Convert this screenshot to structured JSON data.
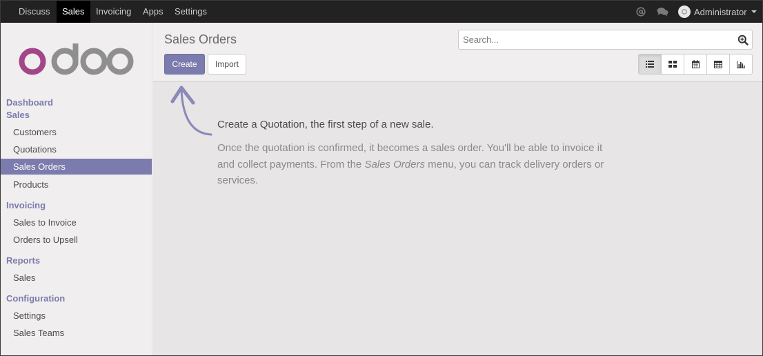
{
  "topbar": {
    "menus": [
      "Discuss",
      "Sales",
      "Invoicing",
      "Apps",
      "Settings"
    ],
    "active_menu": "Sales",
    "user_name": "Administrator",
    "icons": [
      "at-icon",
      "chat-icon"
    ]
  },
  "sidebar": {
    "logo_text": "odoo",
    "sections": [
      {
        "label": "Dashboard",
        "items": []
      },
      {
        "label": "Sales",
        "items": [
          "Customers",
          "Quotations",
          "Sales Orders",
          "Products"
        ]
      },
      {
        "label": "Invoicing",
        "items": [
          "Sales to Invoice",
          "Orders to Upsell"
        ]
      },
      {
        "label": "Reports",
        "items": [
          "Sales"
        ]
      },
      {
        "label": "Configuration",
        "items": [
          "Settings",
          "Sales Teams"
        ]
      }
    ],
    "active_item": "Sales Orders"
  },
  "control": {
    "title": "Sales Orders",
    "create_label": "Create",
    "import_label": "Import",
    "search_placeholder": "Search...",
    "views": [
      "list-view-icon",
      "kanban-view-icon",
      "calendar-view-icon",
      "pivot-view-icon",
      "graph-view-icon"
    ],
    "active_view": "list-view-icon"
  },
  "help": {
    "title": "Create a Quotation, the first step of a new sale.",
    "body_part1": "Once the quotation is confirmed, it becomes a sales order. You'll be able to invoice it and collect payments. From the ",
    "body_emphasis": "Sales Orders",
    "body_part2": " menu, you can track delivery orders or services."
  },
  "colors": {
    "accent": "#7c7bad",
    "topbar": "#222222",
    "logo_o": "#a24689",
    "logo_doo": "#8f8f8f"
  }
}
